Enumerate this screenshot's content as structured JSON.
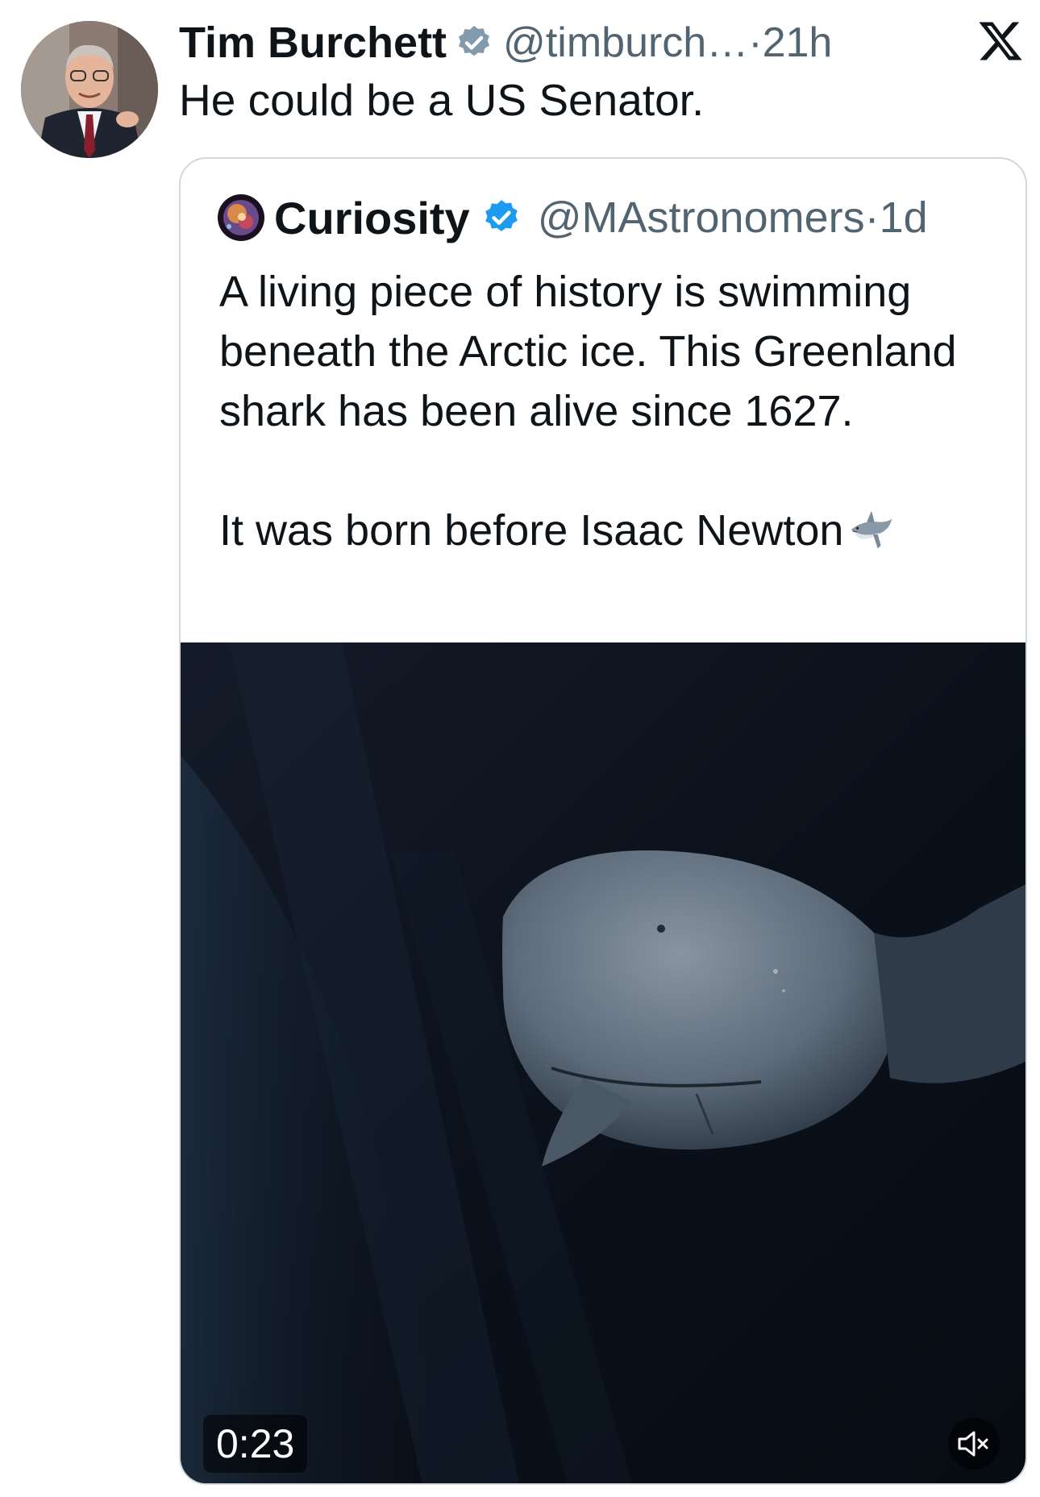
{
  "tweet": {
    "author_name": "Tim Burchett",
    "handle": "@timburch…",
    "separator": "·",
    "time": "21h",
    "text": "He could be a US Senator.",
    "platform_icon": "x-logo-icon",
    "verified_icon": "verified-badge-icon"
  },
  "quoted_tweet": {
    "author_name": "Curiosity",
    "handle": "@MAstronomers",
    "separator": "·",
    "time": "1d",
    "verified_icon": "verified-badge-icon",
    "text_lines": [
      "A living piece of history is swimming beneath the Arctic ice. This Greenland shark has been alive since 1627.",
      "It was born before Isaac Newton"
    ],
    "emoji": "shark-emoji-icon",
    "video": {
      "duration": "0:23",
      "muted_icon": "speaker-muted-icon"
    }
  }
}
